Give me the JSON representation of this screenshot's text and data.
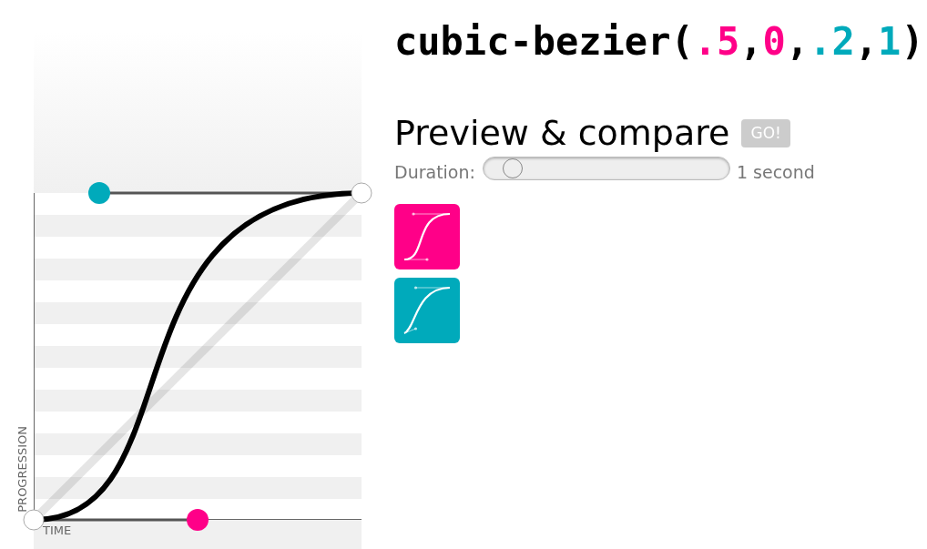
{
  "formula": {
    "tokens": [
      {
        "kind": "text",
        "text": "cubic-bezier("
      },
      {
        "kind": "number",
        "text": ".5",
        "color": "#ff0088"
      },
      {
        "kind": "text",
        "text": ","
      },
      {
        "kind": "number",
        "text": "0",
        "color": "#ff0088"
      },
      {
        "kind": "text",
        "text": ","
      },
      {
        "kind": "number",
        "text": ".2",
        "color": "#00aabb"
      },
      {
        "kind": "text",
        "text": ","
      },
      {
        "kind": "number",
        "text": "1",
        "color": "#00aabb"
      },
      {
        "kind": "text",
        "text": ")"
      }
    ]
  },
  "curve_editor": {
    "y_axis_label": "PROGRESSION",
    "x_axis_label": "TIME",
    "handles": [
      {
        "color": "#ff0088"
      },
      {
        "color": "#00aabb"
      }
    ]
  },
  "preview": {
    "title": "Preview & compare",
    "go_button": "GO!",
    "duration": {
      "label": "Duration:",
      "level": 0.08,
      "reading": "1 second"
    },
    "tiles": [
      {
        "kind": "current",
        "color": "#ff0088"
      },
      {
        "kind": "compare",
        "color": "#00aabb"
      }
    ]
  }
}
